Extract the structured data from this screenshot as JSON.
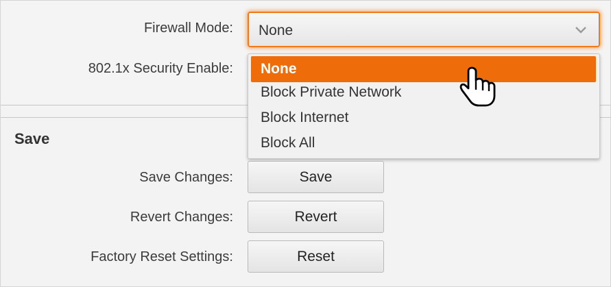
{
  "settings": {
    "firewall_mode_label": "Firewall Mode:",
    "security_label": "802.1x Security Enable:"
  },
  "firewall_select": {
    "value": "None",
    "options": [
      "None",
      "Block Private Network",
      "Block Internet",
      "Block All"
    ],
    "selected_index": 0
  },
  "save_section": {
    "title": "Save",
    "save_changes_label": "Save Changes:",
    "save_button": "Save",
    "revert_changes_label": "Revert Changes:",
    "revert_button": "Revert",
    "factory_reset_label": "Factory Reset Settings:",
    "reset_button": "Reset"
  },
  "colors": {
    "accent": "#ee6c0a",
    "focus_border": "#f07a1a",
    "background": "#f3f3f3"
  },
  "icons": {
    "select_arrow": "chevron-down-icon",
    "pointer": "hand-cursor-icon"
  }
}
